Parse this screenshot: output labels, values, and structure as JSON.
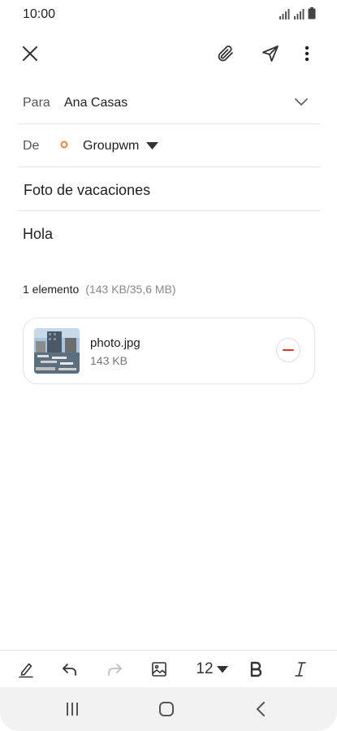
{
  "status_bar": {
    "time": "10:00"
  },
  "compose": {
    "to_label": "Para",
    "to_value": "Ana Casas",
    "from_label": "De",
    "from_value": "Groupwm",
    "subject": "Foto de vacaciones",
    "body": "Hola"
  },
  "attachments": {
    "summary": "1 elemento",
    "size_summary": "(143 KB/35,6 MB)",
    "items": [
      {
        "name": "photo.jpg",
        "size": "143 KB"
      }
    ]
  },
  "format_bar": {
    "font_size": "12"
  },
  "icons": {
    "close": "close-icon",
    "attach": "paperclip-icon",
    "send": "send-icon",
    "more": "more-vert-icon",
    "expand": "chevron-down-icon",
    "account": "account-ring-icon",
    "dropdown": "caret-down-icon",
    "remove": "remove-attachment-icon",
    "pen": "pen-icon",
    "undo": "undo-icon",
    "redo": "redo-icon",
    "image": "image-icon",
    "bold": "bold-icon",
    "italic": "italic-icon",
    "recents": "recents-icon",
    "home": "home-icon",
    "back": "back-icon"
  },
  "colors": {
    "account_ring": "#e8833a",
    "remove": "#e3342f",
    "nav_bg": "#f2f2f2"
  }
}
